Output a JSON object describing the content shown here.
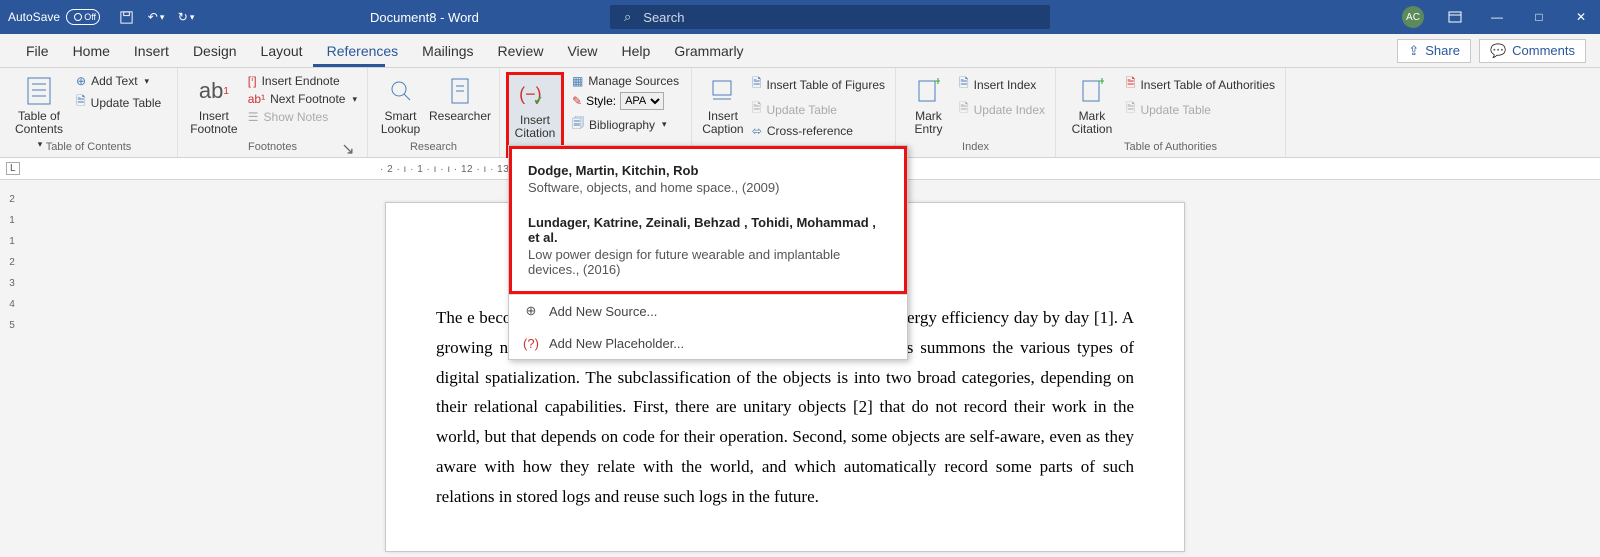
{
  "titlebar": {
    "autosave_label": "AutoSave",
    "autosave_state": "Off",
    "doc_title": "Document8  -  Word",
    "search_placeholder": "Search",
    "avatar_initials": "AC"
  },
  "tabs": {
    "items": [
      "File",
      "Home",
      "Insert",
      "Design",
      "Layout",
      "References",
      "Mailings",
      "Review",
      "View",
      "Help",
      "Grammarly"
    ],
    "active": "References",
    "share": "Share",
    "comments": "Comments"
  },
  "ribbon": {
    "toc": {
      "big": "Table of\nContents",
      "add_text": "Add Text",
      "update_table": "Update Table",
      "group": "Table of Contents"
    },
    "footnotes": {
      "big": "Insert\nFootnote",
      "insert_endnote": "Insert Endnote",
      "next_footnote": "Next Footnote",
      "show_notes": "Show Notes",
      "group": "Footnotes"
    },
    "research": {
      "smart": "Smart\nLookup",
      "researcher": "Researcher",
      "group": "Research"
    },
    "citations": {
      "insert_citation": "Insert\nCitation",
      "manage_sources": "Manage Sources",
      "style_label": "Style:",
      "style_value": "APA",
      "bibliography": "Bibliography"
    },
    "captions": {
      "big": "Insert\nCaption",
      "insert_tof": "Insert Table of Figures",
      "update_table": "Update Table",
      "cross_ref": "Cross-reference"
    },
    "index": {
      "big": "Mark\nEntry",
      "insert_index": "Insert Index",
      "update_index": "Update Index",
      "group": "Index"
    },
    "toa": {
      "big": "Mark\nCitation",
      "insert_toa": "Insert Table of Authorities",
      "update_table": "Update Table",
      "group": "Table of Authorities"
    }
  },
  "citation_menu": {
    "items": [
      {
        "authors": "Dodge, Martin,  Kitchin, Rob",
        "desc": "Software, objects, and home space., (2009)"
      },
      {
        "authors": "Lundager, Katrine, Zeinali, Behzad , Tohidi, Mohammad , et al.",
        "desc": "Low power design for future wearable and implantable devices., (2016)"
      }
    ],
    "add_source": "Add New Source...",
    "add_placeholder": "Add New Placeholder..."
  },
  "ruler": {
    "left_marker": "L",
    "h_marks": "· 2 · ı · 1 · ı ·                                                                                                                        ı · 12 · ı · 13 · ı · 14 · ı · 15 · ı · △ · ı · 17 · ı · 18 ·",
    "v_marks": [
      "2",
      "·",
      "1",
      "·",
      "·",
      "1",
      "·",
      "2",
      "·",
      "3",
      "·",
      "4",
      "·",
      "5",
      "·"
    ]
  },
  "document": {
    "body": "The                                                                                                                e  becoming  smarter,  cheaper (affordable),  portable,  and  more  energy  efficiency  day  by  day  [1].  A  growing  number  of ordinary  devices  populating  the  social  domains  summons  the  various  types  of  digital spatialization. The subclassification of the objects is into two broad categories, depending on their relational capabilities. First, there are unitary objects [2] that do not record their work in the world, but that depends on code for their operation. Second, some objects are self-aware, even as they aware with how they relate with the world, and which automatically record some parts of such relations in stored logs and reuse such logs in the future."
  }
}
